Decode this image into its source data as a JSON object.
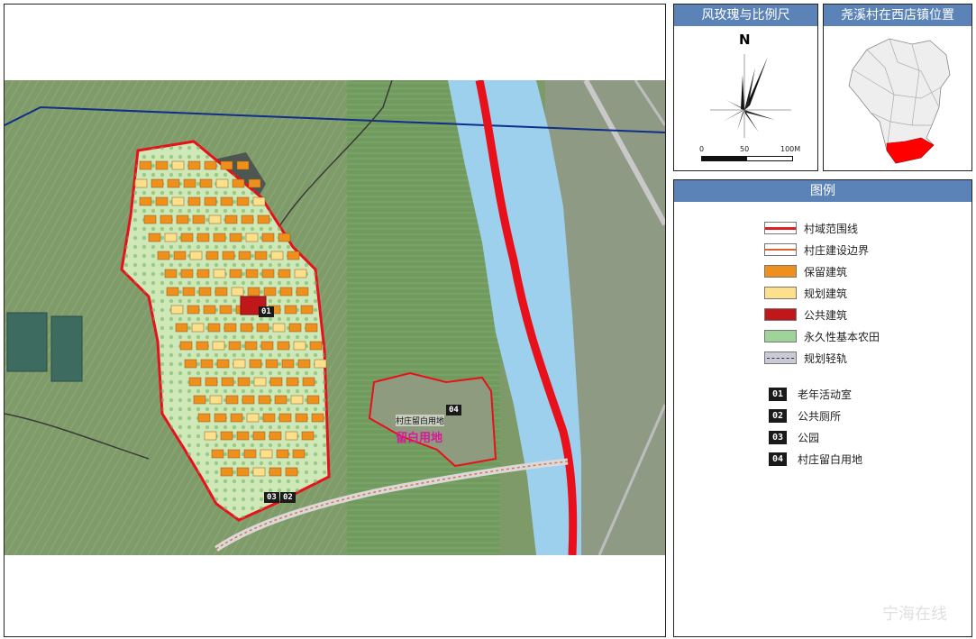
{
  "compass_panel": {
    "title": "风玫瑰与比例尺",
    "north_label": "N",
    "scale": {
      "labels": [
        "0",
        "50",
        "100M"
      ]
    }
  },
  "location_panel": {
    "title": "尧溪村在西店镇位置",
    "highlight_color": "#ff0000"
  },
  "legend_panel": {
    "title": "图例",
    "items": [
      {
        "label": "村域范围线",
        "color": "#e02020"
      },
      {
        "label": "村庄建设边界",
        "color": "#e06030"
      },
      {
        "label": "保留建筑",
        "color": "#f0901c"
      },
      {
        "label": "规划建筑",
        "color": "#fce08c"
      },
      {
        "label": "公共建筑",
        "color": "#c0171b"
      },
      {
        "label": "永久性基本农田",
        "color": "#9fd39a"
      },
      {
        "label": "规划轻轨",
        "color": "#c8cbd6"
      }
    ],
    "codes": [
      {
        "code": "01",
        "label": "老年活动室"
      },
      {
        "code": "02",
        "label": "公共厕所"
      },
      {
        "code": "03",
        "label": "公园"
      },
      {
        "code": "04",
        "label": "村庄留白用地"
      }
    ]
  },
  "map": {
    "labels": {
      "reserve_land_small": "村庄留白用地",
      "reserve_land_big": "留白用地",
      "badge_01": "01",
      "badge_02": "02",
      "badge_03": "03",
      "badge_04": "04"
    },
    "colors": {
      "river": "#9dd0ec",
      "boundary": "#e8101a",
      "satellite": "#7c9a6b"
    }
  },
  "watermark": "宁海在线"
}
